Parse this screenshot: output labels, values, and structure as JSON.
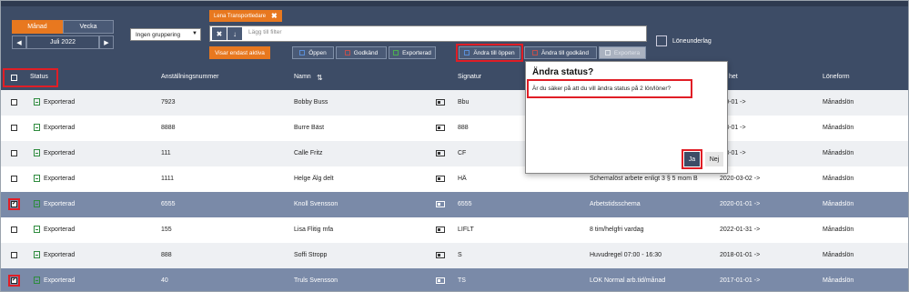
{
  "period": {
    "tab_month": "Månad",
    "tab_week": "Vecka",
    "current": "Juli 2022",
    "prev_icon": "arrow-left-icon",
    "next_icon": "arrow-right-icon"
  },
  "grouping": {
    "selected": "Ingen gruppering"
  },
  "filter": {
    "chip_label": "Lena Transportledare",
    "placeholder": "Lägg till filter"
  },
  "actions": {
    "show_only_active": "Visar endast aktiva",
    "open": "Öppen",
    "approved": "Godkänd",
    "exported": "Exporterad",
    "change_to_open": "Ändra till öppen",
    "change_to_approved": "Ändra till godkänd",
    "export": "Exportera",
    "payroll_basis": "Löneunderlag"
  },
  "columns": {
    "status": "Status",
    "employee_number": "Anställningsnummer",
    "name": "Namn",
    "signature": "Signatur",
    "valid_from": "het",
    "pay_form": "Löneform"
  },
  "rows": [
    {
      "status": "Exporterad",
      "number": "7923",
      "name": "Bobby Buss",
      "signature": "Bbu",
      "schedule": "",
      "date": "-10-01 ->",
      "pay": "Månadslön",
      "checked": false
    },
    {
      "status": "Exporterad",
      "number": "8888",
      "name": "Burre Bäst",
      "signature": "888",
      "schedule": "",
      "date": "-03-01 ->",
      "pay": "Månadslön",
      "checked": false
    },
    {
      "status": "Exporterad",
      "number": "111",
      "name": "Calle Fritz",
      "signature": "CF",
      "schedule": "",
      "date": "-08-01 ->",
      "pay": "Månadslön",
      "checked": false
    },
    {
      "status": "Exporterad",
      "number": "1111",
      "name": "Helge Älg delt",
      "signature": "HÄ",
      "schedule": "Schemalöst arbete enligt 3 § 5 mom B",
      "date": "2020-03-02 ->",
      "pay": "Månadslön",
      "checked": false
    },
    {
      "status": "Exporterad",
      "number": "6555",
      "name": "Knoll Svensson",
      "signature": "6555",
      "schedule": "Arbetstidsschema",
      "date": "2020-01-01 ->",
      "pay": "Månadslön",
      "checked": true
    },
    {
      "status": "Exporterad",
      "number": "155",
      "name": "Lisa Flitig mfa",
      "signature": "LIFLT",
      "schedule": "8 tim/helgfri vardag",
      "date": "2022-01-31 ->",
      "pay": "Månadslön",
      "checked": false
    },
    {
      "status": "Exporterad",
      "number": "888",
      "name": "Soffi Stropp",
      "signature": "S",
      "schedule": "Huvudregel 07:00 - 16:30",
      "date": "2018-01-01 ->",
      "pay": "Månadslön",
      "checked": false
    },
    {
      "status": "Exporterad",
      "number": "40",
      "name": "Truls Svensson",
      "signature": "TS",
      "schedule": "LOK Normal arb.tid/månad",
      "date": "2017-01-01 ->",
      "pay": "Månadslön",
      "checked": true
    }
  ],
  "dialog": {
    "title": "Ändra status?",
    "message": "Är du säker på att du vill ändra status på 2 lön/löner?",
    "yes": "Ja",
    "no": "Nej"
  },
  "colors": {
    "header": "#3d4c66",
    "accent": "#e8781f",
    "highlight": "#e01e26",
    "selected_row": "#7a8aa8"
  }
}
